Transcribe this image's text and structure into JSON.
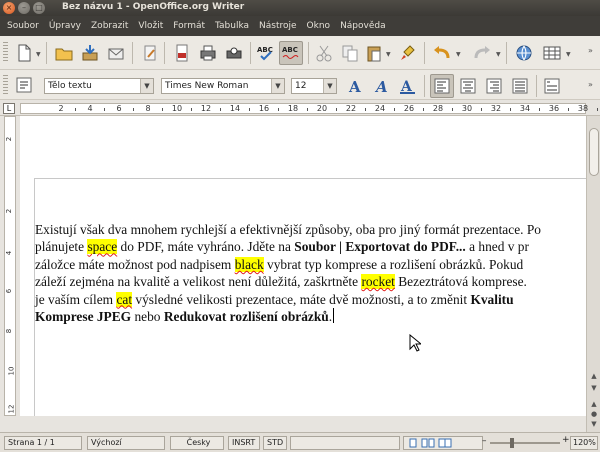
{
  "window": {
    "title": "Bez názvu 1 - OpenOffice.org Writer",
    "close_glyph": "×",
    "min_glyph": "–",
    "max_glyph": "□"
  },
  "menu": [
    "Soubor",
    "Úpravy",
    "Zobrazit",
    "Vložit",
    "Formát",
    "Tabulka",
    "Nástroje",
    "Okno",
    "Nápověda"
  ],
  "formatting": {
    "style": "Tělo textu",
    "font": "Times New Roman",
    "size": "12"
  },
  "ruler": {
    "corner_glyph": "L",
    "marks": [
      "2",
      "4",
      "6",
      "8",
      "10",
      "12",
      "14",
      "16",
      "18",
      "20",
      "22",
      "24",
      "26",
      "28",
      "30",
      "32",
      "34",
      "36",
      "38"
    ],
    "vmarks": [
      "2",
      "2",
      "4",
      "6",
      "8",
      "10",
      "12"
    ]
  },
  "document": {
    "lines": [
      [
        {
          "t": "Existují však dva mnohem rychlejší a efektivnější způsoby, oba pro jiný formát prezentace. Po"
        }
      ],
      [
        {
          "t": "plánujete "
        },
        {
          "t": "space",
          "hl": true,
          "sp": true
        },
        {
          "t": " do PDF, máte vyhráno. Jděte na "
        },
        {
          "t": "Soubor | Exportovat do PDF...",
          "b": true
        },
        {
          "t": " a hned v pr"
        }
      ],
      [
        {
          "t": "záložce máte možnost pod nadpisem "
        },
        {
          "t": "black",
          "hl": true,
          "sp": true
        },
        {
          "t": " vybrat typ komprese a rozlišení obrázků. Pokud"
        }
      ],
      [
        {
          "t": "záleží zejména na kvalitě a velikost není důležitá, zaškrtněte "
        },
        {
          "t": "rocket",
          "hl": true,
          "sp": true
        },
        {
          "t": " Bezeztrátová komprese."
        }
      ],
      [
        {
          "t": "je vaším cílem "
        },
        {
          "t": "cat",
          "hl": true,
          "sp": true
        },
        {
          "t": " výsledné velikosti prezentace, máte dvě možnosti, a to změnit "
        },
        {
          "t": "Kvalitu",
          "b": true
        }
      ],
      [
        {
          "t": "Komprese JPEG",
          "b": true
        },
        {
          "t": " nebo "
        },
        {
          "t": "Redukovat rozlišení obrázků",
          "b": true
        },
        {
          "t": "."
        }
      ]
    ]
  },
  "status": {
    "page": "Strana 1 / 1",
    "style": "Výchozí",
    "language": "Česky",
    "insert_mode": "INSRT",
    "selection_mode": "STD",
    "zoom": "120%"
  },
  "icons": [
    "new-document-icon",
    "open-icon",
    "save-icon",
    "email-icon",
    "edit-icon",
    "export-pdf-icon",
    "print-icon",
    "print-preview-icon",
    "spellcheck-icon",
    "autospellcheck-icon",
    "cut-icon",
    "copy-icon",
    "paste-icon",
    "format-paintbrush-icon",
    "undo-icon",
    "redo-icon",
    "hyperlink-icon",
    "table-icon",
    "bold-icon",
    "italic-icon",
    "underline-icon",
    "align-left-icon",
    "align-center-icon",
    "align-right-icon",
    "justify-icon",
    "paragraph-icon"
  ]
}
